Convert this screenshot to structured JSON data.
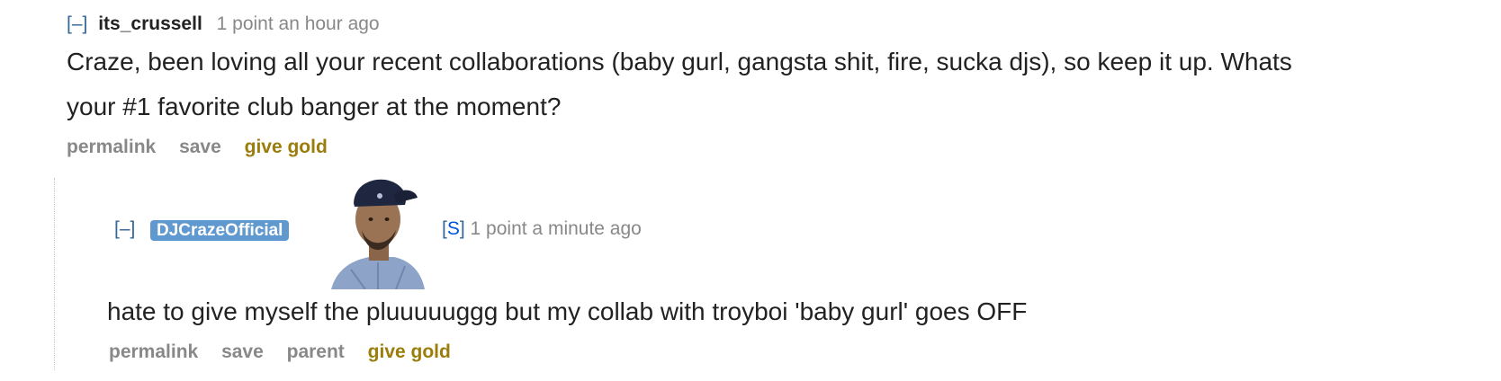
{
  "parent_comment": {
    "expand_label": "[–]",
    "author": "its_crussell",
    "meta": "1 point an hour ago",
    "body": "Craze, been loving all your recent collaborations (baby gurl, gangsta shit, fire, sucka djs), so keep it up. Whats your #1 favorite club banger at the moment?",
    "buttons": {
      "permalink": "permalink",
      "save": "save",
      "give_gold": "give gold"
    }
  },
  "reply": {
    "expand_label": "[–]",
    "author": "DJCrazeOfficial",
    "submitter_open": "[",
    "submitter_letter": "S",
    "submitter_close": "]",
    "meta": "1 point a minute ago",
    "body": "hate to give myself the pluuuuuggg but my collab with troyboi 'baby gurl' goes OFF",
    "buttons": {
      "permalink": "permalink",
      "save": "save",
      "parent": "parent",
      "give_gold": "give gold"
    }
  },
  "colors": {
    "link_blue": "#336699",
    "flair_blue": "#5f99cf",
    "gold": "#9a7d0a",
    "muted": "#888888"
  }
}
